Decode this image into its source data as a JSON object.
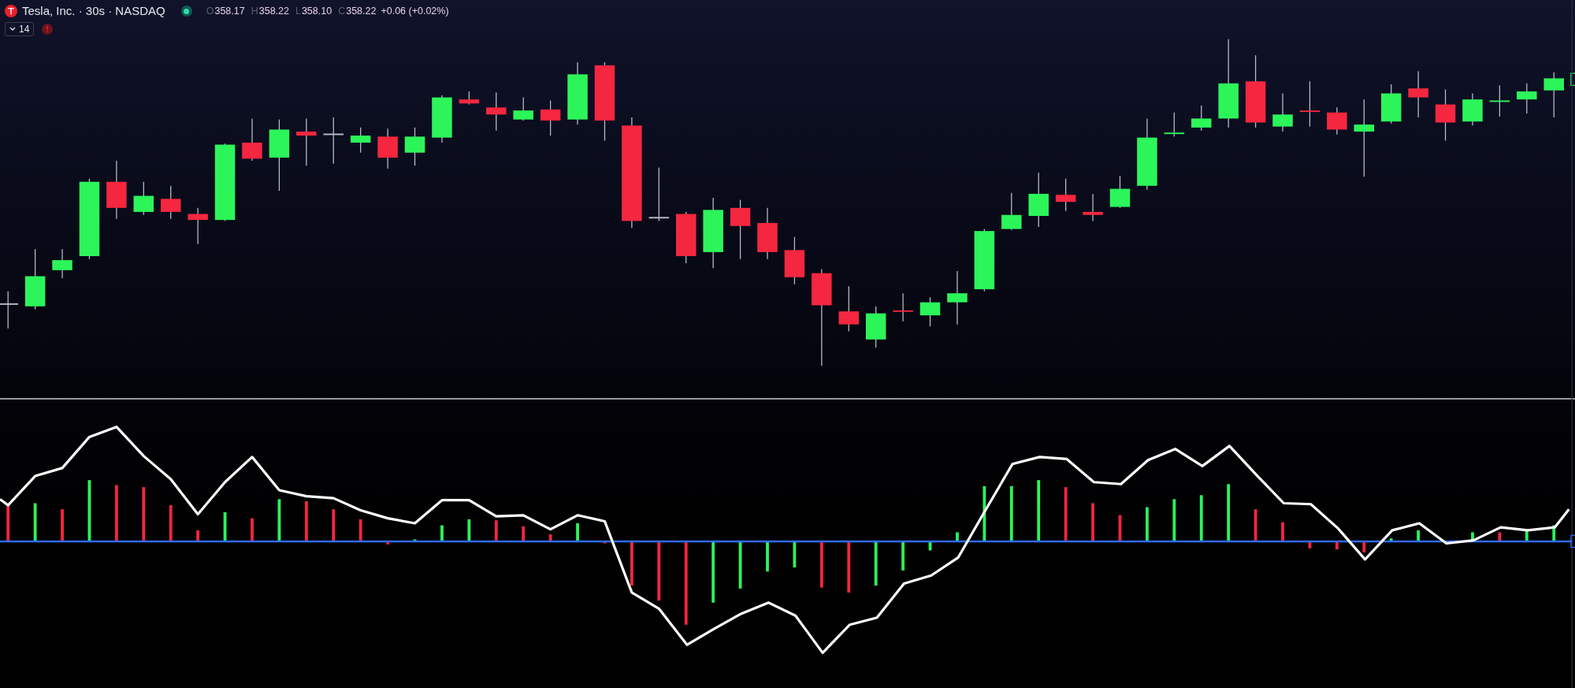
{
  "legend": {
    "title": "Tesla, Inc. · 30s · NASDAQ",
    "ohlc": [
      {
        "label": "O",
        "value": "358.17"
      },
      {
        "label": "H",
        "value": "358.22"
      },
      {
        "label": "L",
        "value": "358.10"
      },
      {
        "label": "C",
        "value": "358.22"
      }
    ],
    "change": "+0.06 (+0.02%)"
  },
  "indicator": {
    "value": "14",
    "expanded": false
  }
}
